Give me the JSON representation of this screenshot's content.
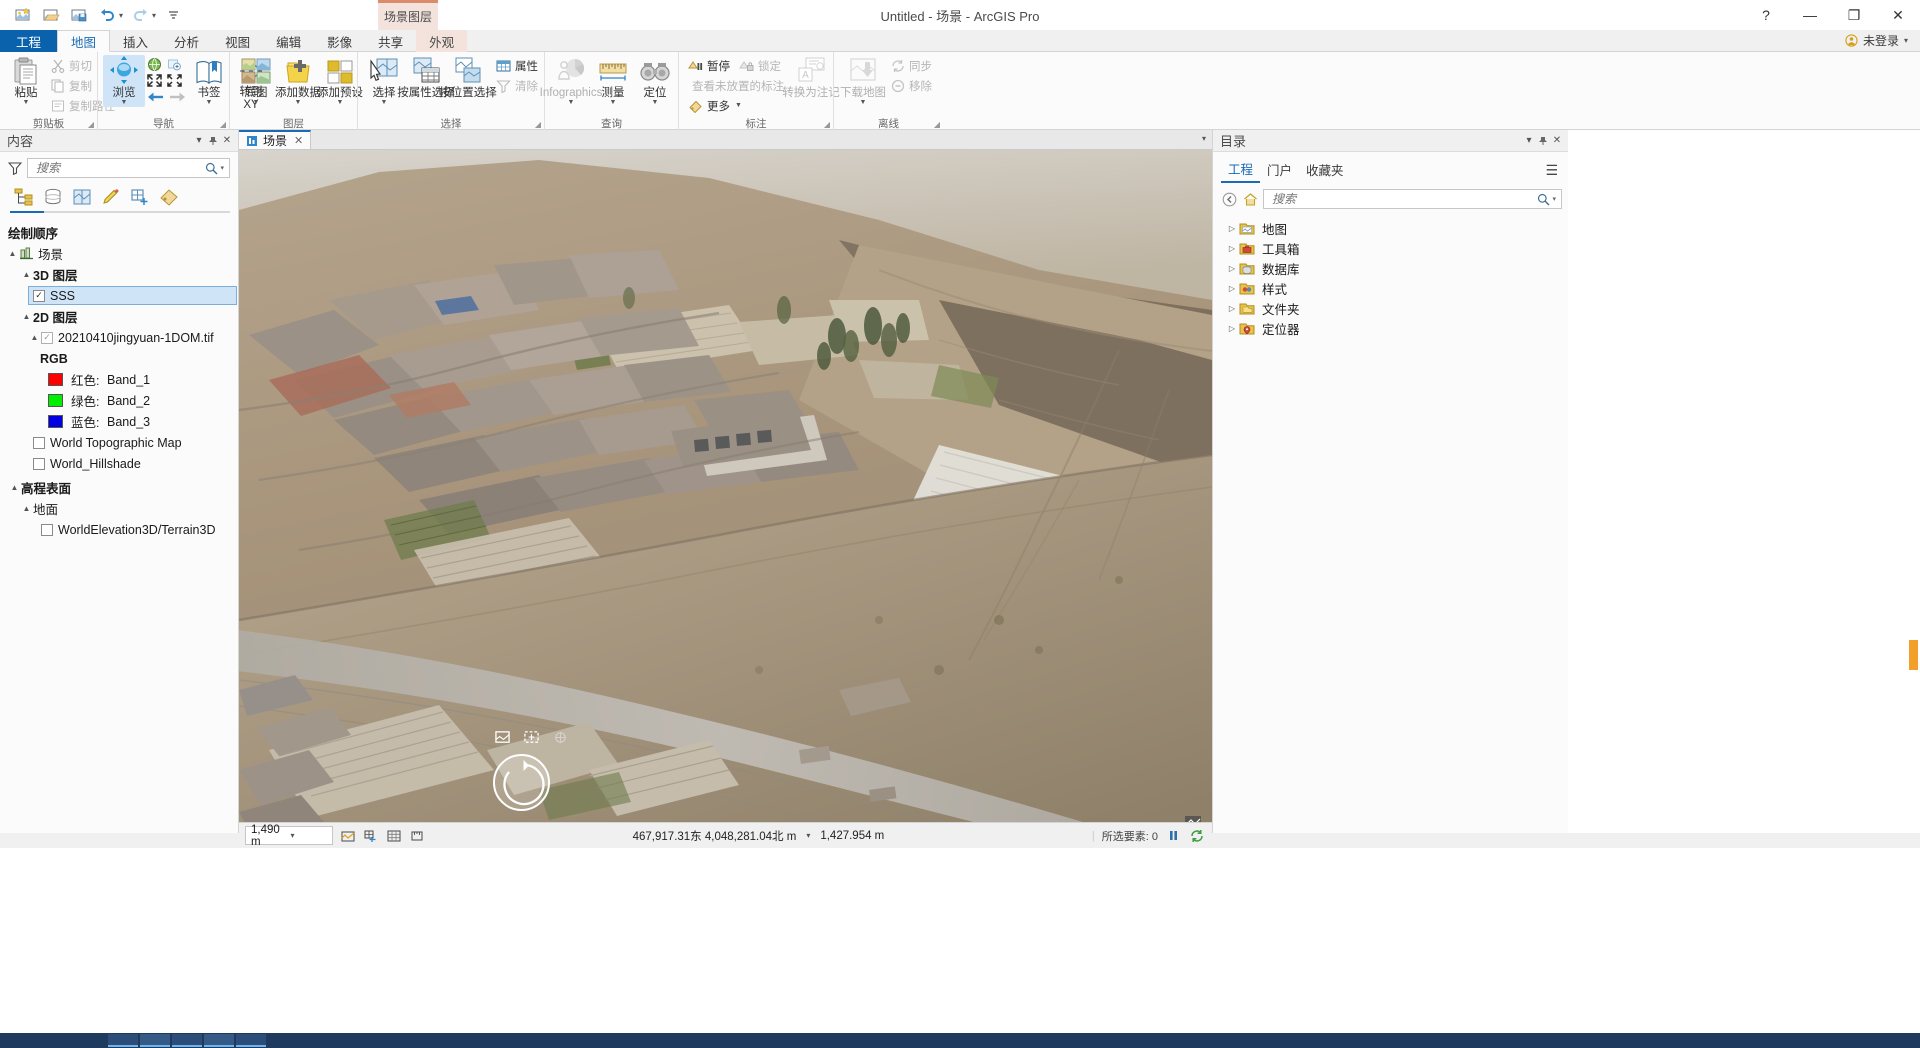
{
  "window": {
    "title": "Untitled - 场景 - ArcGIS Pro",
    "minimize": "—",
    "maximize": "❐",
    "close": "✕",
    "help": "?"
  },
  "quick_access": {
    "new_project": "new-project",
    "open_project": "open-project",
    "save_project": "save-project",
    "undo": "undo",
    "redo": "redo",
    "customize": "customize"
  },
  "account": {
    "label": "未登录",
    "caret": "▾"
  },
  "contextual_tab_header": "场景图层",
  "tabs": [
    {
      "label": "工程",
      "state": "project"
    },
    {
      "label": "地图",
      "state": "active"
    },
    {
      "label": "插入",
      "state": "normal"
    },
    {
      "label": "分析",
      "state": "normal"
    },
    {
      "label": "视图",
      "state": "normal"
    },
    {
      "label": "编辑",
      "state": "normal"
    },
    {
      "label": "影像",
      "state": "normal"
    },
    {
      "label": "共享",
      "state": "normal"
    },
    {
      "label": "外观",
      "state": "contextual"
    }
  ],
  "ribbon": {
    "groups": [
      {
        "name": "剪贴板",
        "has_dialog_launcher": true,
        "big": [
          {
            "label": "粘贴",
            "dropdown": true,
            "icon": "paste-icon"
          }
        ],
        "small": [
          {
            "label": "剪切",
            "icon": "cut-icon",
            "disabled": true
          },
          {
            "label": "复制",
            "icon": "copy-icon",
            "disabled": true
          },
          {
            "label": "复制路径",
            "icon": "copy-path-icon",
            "disabled": true
          }
        ]
      },
      {
        "name": "导航",
        "has_dialog_launcher": true,
        "big": [
          {
            "label": "浏览",
            "dropdown": true,
            "icon": "explore-icon",
            "selected": true
          },
          {
            "label": "书签",
            "dropdown": true,
            "icon": "bookmark-icon"
          },
          {
            "label": "转到 XY",
            "label_line1": "转到",
            "label_line2": "XY",
            "dropdown": false,
            "icon": "go-to-xy-icon"
          }
        ],
        "mini": [
          {
            "icon": "full-extent-icon"
          },
          {
            "icon": "fixed-zoom-in-icon"
          },
          {
            "icon": "zoom-in-fixed-icon"
          },
          {
            "icon": "zoom-out-fixed-icon"
          },
          {
            "icon": "previous-extent-icon"
          },
          {
            "icon": "next-extent-icon"
          }
        ]
      },
      {
        "name": "图层",
        "big": [
          {
            "label": "底图",
            "dropdown": true,
            "icon": "basemap-icon"
          },
          {
            "label": "添加数据",
            "dropdown": true,
            "icon": "add-data-icon"
          },
          {
            "label": "添加预设",
            "dropdown": true,
            "icon": "add-preset-icon"
          }
        ]
      },
      {
        "name": "选择",
        "has_dialog_launcher": true,
        "big": [
          {
            "label": "选择",
            "dropdown": true,
            "icon": "select-icon"
          },
          {
            "label": "按属性选择",
            "dropdown": false,
            "icon": "select-by-attributes-icon"
          },
          {
            "label": "按位置选择",
            "dropdown": false,
            "icon": "select-by-location-icon"
          }
        ],
        "small": [
          {
            "label": "属性",
            "icon": "attribute-table-icon",
            "disabled": false
          },
          {
            "label": "清除",
            "icon": "clear-selection-icon",
            "disabled": true
          }
        ]
      },
      {
        "name": "查询",
        "big": [
          {
            "label": "Infographics",
            "dropdown": true,
            "icon": "infographics-icon",
            "disabled": true
          },
          {
            "label": "测量",
            "dropdown": true,
            "icon": "measure-icon"
          },
          {
            "label": "定位",
            "dropdown": true,
            "icon": "locate-icon"
          }
        ]
      },
      {
        "name": "标注",
        "has_dialog_launcher": true,
        "small": [
          {
            "label": "暂停",
            "icon": "pause-labeling-icon",
            "disabled": false
          },
          {
            "label": "锁定",
            "icon": "lock-labels-icon",
            "disabled": true
          },
          {
            "label": "查看未放置的标注",
            "icon": "view-unplaced-labels-icon",
            "disabled": true
          },
          {
            "label": "更多",
            "icon": "more-labeling-icon",
            "dropdown": true,
            "disabled": false
          }
        ],
        "big": [
          {
            "label": "转换为注记",
            "dropdown": false,
            "icon": "convert-to-annotation-icon",
            "disabled": true
          }
        ]
      },
      {
        "name": "离线",
        "has_dialog_launcher": true,
        "big": [
          {
            "label": "下载地图",
            "dropdown": true,
            "icon": "download-map-icon",
            "disabled": true
          }
        ],
        "small": [
          {
            "label": "同步",
            "icon": "sync-icon",
            "disabled": true
          },
          {
            "label": "移除",
            "icon": "remove-icon",
            "disabled": true
          }
        ]
      }
    ]
  },
  "contents_panel": {
    "title": "内容",
    "pin": "pin-icon",
    "menu": "▾",
    "close": "✕",
    "search": {
      "placeholder": "搜索",
      "value": "",
      "filter_icon": "filter-icon",
      "search_icon": "search-icon",
      "caret": "▾"
    },
    "view_tabs": [
      {
        "icon": "list-by-drawing-order-icon",
        "active": true
      },
      {
        "icon": "list-by-data-source-icon",
        "active": false
      },
      {
        "icon": "list-by-selection-icon",
        "active": false
      },
      {
        "icon": "list-by-editing-icon",
        "active": false
      },
      {
        "icon": "list-by-snapping-icon",
        "active": false
      },
      {
        "icon": "list-by-labeling-icon",
        "active": false
      }
    ],
    "section_label": "绘制顺序",
    "tree": [
      {
        "level": 0,
        "label": "场景",
        "twisty": "▲",
        "icon": "scene-icon",
        "checkbox": "none",
        "bold": false
      },
      {
        "level": 1,
        "label": "3D 图层",
        "twisty": "▲",
        "icon": "none",
        "checkbox": "none",
        "bold": true
      },
      {
        "level": 2,
        "label": "SSS",
        "twisty": "none",
        "icon": "none",
        "checkbox": "checked",
        "bold": false,
        "selected": true
      },
      {
        "level": 1,
        "label": "2D 图层",
        "twisty": "▲",
        "icon": "none",
        "checkbox": "none",
        "bold": true
      },
      {
        "level": 2,
        "label": "20210410jingyuan-1DOM.tif",
        "twisty": "▲",
        "icon": "none",
        "checkbox": "checked-gray",
        "bold": false
      },
      {
        "level": 3,
        "label": "RGB",
        "twisty": "none",
        "icon": "none",
        "checkbox": "none",
        "bold": true
      },
      {
        "level": 4,
        "label": "红色:",
        "value": "Band_1",
        "swatch": "#ff0000",
        "twisty": "none",
        "checkbox": "none",
        "bold": false
      },
      {
        "level": 4,
        "label": "绿色:",
        "value": "Band_2",
        "swatch": "#00ee00",
        "twisty": "none",
        "checkbox": "none",
        "bold": false
      },
      {
        "level": 4,
        "label": "蓝色:",
        "value": "Band_3",
        "swatch": "#0000e0",
        "twisty": "none",
        "checkbox": "none",
        "bold": false
      },
      {
        "level": 2,
        "label": "World Topographic Map",
        "twisty": "none",
        "icon": "none",
        "checkbox": "unchecked",
        "bold": false
      },
      {
        "level": 2,
        "label": "World_Hillshade",
        "twisty": "none",
        "icon": "none",
        "checkbox": "unchecked",
        "bold": false
      },
      {
        "level": 0,
        "label": "高程表面",
        "twisty": "▲",
        "icon": "none",
        "checkbox": "none",
        "bold": true
      },
      {
        "level": 1,
        "label": "地面",
        "twisty": "▲",
        "icon": "none",
        "checkbox": "none",
        "bold": false
      },
      {
        "level": 2,
        "label": "WorldElevation3D/Terrain3D",
        "twisty": "none",
        "icon": "none",
        "checkbox": "unchecked",
        "bold": false
      }
    ]
  },
  "map_view": {
    "tab_label": "场景",
    "tab_icon": "scene-view-icon",
    "tab_close": "✕",
    "tabstrip_caret": "▾",
    "overlay_buttons": [
      {
        "icon": "full-extent-overlay-icon"
      },
      {
        "icon": "explore-overlay-icon"
      },
      {
        "icon": "link-views-overlay-icon"
      }
    ],
    "navigator": "on-screen-navigator",
    "corner_icon": "attribution-icon"
  },
  "map_status": {
    "scale_value": "1,490 m",
    "scale_caret": "▾",
    "buttons": [
      {
        "icon": "selected-features-icon"
      },
      {
        "icon": "snapping-icon"
      },
      {
        "icon": "grid-icon"
      },
      {
        "icon": "measure-status-icon"
      }
    ],
    "coordinates": "467,917.31东 4,048,281.04北 m",
    "coord_caret": "▾",
    "elevation": "1,427.954 m",
    "selected_count_label": "所选要素: 0",
    "pause_icon": "pause-drawing-icon",
    "refresh_icon": "refresh-icon"
  },
  "catalog_panel": {
    "title": "目录",
    "pin": "pin-icon",
    "menu": "▾",
    "close": "✕",
    "tabs": [
      {
        "label": "工程",
        "active": true
      },
      {
        "label": "门户",
        "active": false
      },
      {
        "label": "收藏夹",
        "active": false
      }
    ],
    "burger": "☰",
    "back_icon": "back-icon",
    "home_icon": "home-icon",
    "search": {
      "placeholder": "搜索",
      "value": "",
      "search_icon": "search-icon",
      "caret": "▾"
    },
    "tree": [
      {
        "label": "地图",
        "icon": "maps-folder-icon",
        "twisty": "▷"
      },
      {
        "label": "工具箱",
        "icon": "toolboxes-folder-icon",
        "twisty": "▷"
      },
      {
        "label": "数据库",
        "icon": "databases-folder-icon",
        "twisty": "▷"
      },
      {
        "label": "样式",
        "icon": "styles-folder-icon",
        "twisty": "▷"
      },
      {
        "label": "文件夹",
        "icon": "folders-folder-icon",
        "twisty": "▷"
      },
      {
        "label": "定位器",
        "icon": "locators-folder-icon",
        "twisty": "▷"
      }
    ]
  },
  "colors": {
    "accent": "#1a6bb5",
    "project_tab": "#0a62ad",
    "contextual": "#d98b6a",
    "selection": "#cfe4f7"
  }
}
